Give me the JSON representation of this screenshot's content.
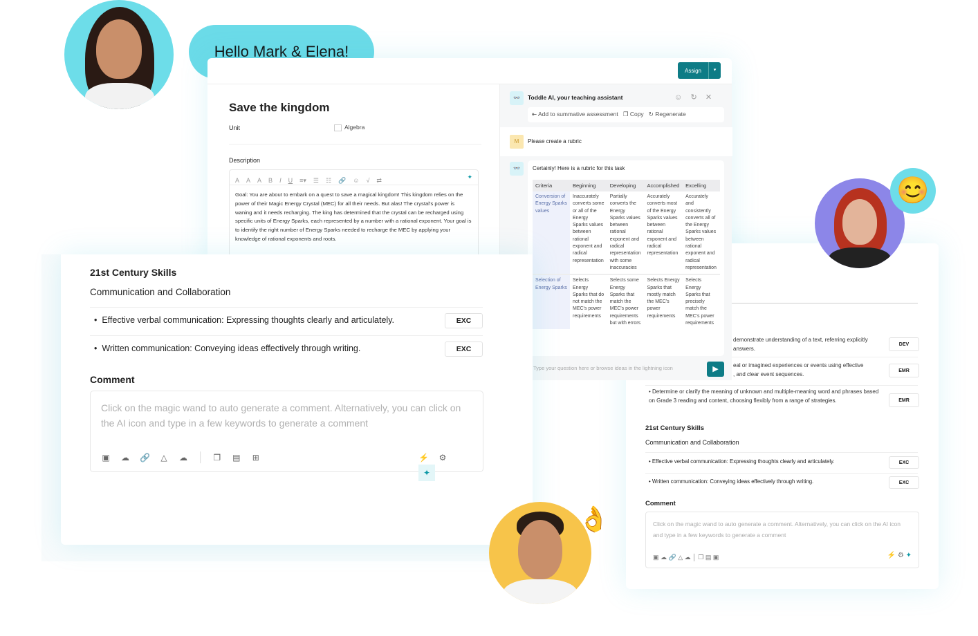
{
  "greeting": "Hello Mark & Elena!",
  "task": {
    "assign_label": "Assign",
    "title": "Save the kingdom",
    "unit_label": "Unit",
    "unit_value": "Algebra",
    "description_label": "Description",
    "description_text": "Goal: You are about to embark on a quest to save a magical kingdom! This kingdom relies on the power of their Magic Energy Crystal (MEC) for all their needs. But alas! The crystal's power is waning and it needs recharging. The king has determined that the crystal can be recharged using specific units of Energy Sparks, each represented by a number with a rational exponent. Your goal is to identify the right number of Energy Sparks needed to recharge the MEC by applying your knowledge of rational exponents and roots."
  },
  "assistant": {
    "title": "Toddle AI, your teaching assistant",
    "actions": [
      "Add to summative assessment",
      "Copy",
      "Regenerate"
    ],
    "user_initial": "M",
    "user_message": "Please create a rubric",
    "reply": "Certainly! Here is a rubric for this task",
    "rubric": {
      "headers": [
        "Criteria",
        "Beginning",
        "Developing",
        "Accomplished",
        "Excelling"
      ],
      "rows": [
        [
          "Conversion of Energy Sparks values",
          "Inaccurately converts some or all of the Energy Sparks values between rational exponent and radical representation",
          "Partially converts the Energy Sparks values between rational exponent and radical representation with some inaccuracies",
          "Accurately converts most of the Energy Sparks values between rational exponent and radical representation",
          "Accurately and consistently converts all of the Energy Sparks values between rational exponent and radical representation"
        ],
        [
          "Selection of Energy Sparks",
          "Selects Energy Sparks that do not match the MEC's power requirements",
          "Selects some Energy Sparks that match the MEC's power requirements but with errors",
          "Selects Energy Sparks that mostly match the MEC's power requirements",
          "Selects Energy Sparks that precisely match the MEC's power requirements"
        ]
      ]
    },
    "input_placeholder": "Type your question here or browse ideas in the lightning icon"
  },
  "front_card": {
    "section_title": "21st Century Skills",
    "subtitle": "Communication and Collaboration",
    "items": [
      {
        "text": "Effective verbal communication: Expressing thoughts clearly and articulately.",
        "level": "EXC"
      },
      {
        "text": "Written communication: Conveying ideas effectively through writing.",
        "level": "EXC"
      }
    ],
    "comment_label": "Comment",
    "comment_placeholder": "Click on the magic wand to auto generate a comment. Alternatively, you can click on the AI icon and type in a few keywords to generate a comment"
  },
  "right_card": {
    "standards": [
      {
        "text": "demonstrate understanding of a text, referring explicitly",
        "text2": "answers.",
        "level": "DEV"
      },
      {
        "text": "eal or imagined experiences or events using effective",
        "text2": ", and clear event sequences.",
        "level": "EMR"
      },
      {
        "text": "Determine or clarify the meaning of unknown and multiple-meaning word and phrases based on Grade 3 reading and content, choosing flexibly from a range of strategies.",
        "level": "EMR"
      }
    ],
    "section_title": "21st Century Skills",
    "subtitle": "Communication and Collaboration",
    "items": [
      {
        "text": "Effective verbal communication: Expressing thoughts clearly and articulately.",
        "level": "EXC"
      },
      {
        "text": "Written communication: Conveying ideas effectively through writing.",
        "level": "EXC"
      }
    ],
    "comment_label": "Comment",
    "comment_placeholder": "Click on the magic wand to auto generate a comment. Alternatively, you can click on the AI icon and type in a few keywords to generate a comment"
  },
  "colors": {
    "accent": "#0e7c86",
    "bubble": "#6bdbe8",
    "avatar_yellow": "#f7c44a",
    "avatar_purple": "#8c86e8"
  }
}
